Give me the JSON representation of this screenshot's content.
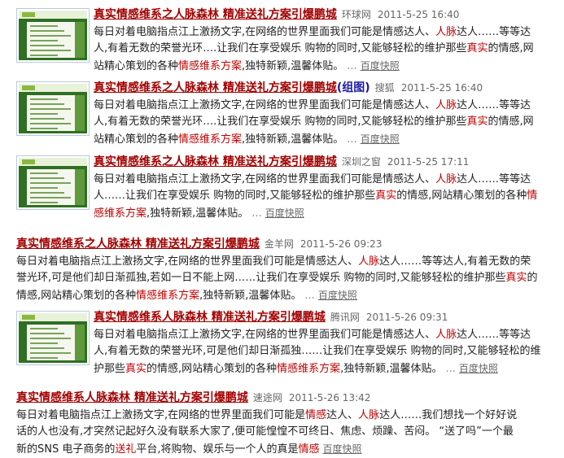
{
  "results": [
    {
      "title": "真实情感维系之人脉森林  精准送礼方案引爆鹏城",
      "source": "环球网",
      "time": "2011-5-25 16:40",
      "lines": [
        [
          "每日对着电脑指点江上激扬文字,在网络的世界里面我们可能是情感达人、",
          {
            "hl": "人脉"
          },
          "达人……等等达"
        ],
        [
          "人,有着无数的荣誉光环….让我们在享受娱乐 购物的同时,又能够轻松的维护那些",
          {
            "hl": "真实"
          },
          "的情感,网"
        ],
        [
          "站精心策划的各种",
          {
            "hl": "情感维系方案"
          },
          ",独特新颖,温馨体贴。"
        ]
      ],
      "dots": "...",
      "cache": "百度快照"
    },
    {
      "title": "真实情感维系之人脉森林  精准送礼方案引爆鹏城",
      "group": "(组图)",
      "source": "搜狐",
      "time": "2011-5-25 16:40",
      "lines": [
        [
          "每日对着电脑指点江上激扬文字,在网络的世界里面我们可能是情感达人、",
          {
            "hl": "人脉"
          },
          "达人……等等达"
        ],
        [
          "人,有着无数的荣誉光环….让我们在享受娱乐 购物的同时,又能够轻松的维护那些",
          {
            "hl": "真实"
          },
          "的情感,网"
        ],
        [
          "站精心策划的各种",
          {
            "hl": "情感维系方案"
          },
          ",独特新颖,温馨体贴。"
        ]
      ],
      "dots": "...",
      "cache": "百度快照"
    },
    {
      "title": "真实情感维系之人脉森林  精准送礼方案引爆鹏城",
      "source": "深圳之窗",
      "time": "2011-5-25 17:11",
      "lines": [
        [
          "每日对着电脑指点江上激扬文字,在网络的世界里面我们可能是情感达人、",
          {
            "hl": "人脉"
          },
          "达人……等等达"
        ],
        [
          "人……让我们在享受娱乐 购物的同时,又能够轻松的维护那些",
          {
            "hl": "真实"
          },
          "的情感,网站精心策划的各种",
          {
            "hl": "情"
          }
        ],
        [
          {
            "hl": "感维系方案"
          },
          ",独特新颖,温馨体贴。"
        ]
      ],
      "dots": "...",
      "cache": "百度快照"
    },
    {
      "title": "真实情感维系之人脉森林  精准送礼方案引爆鹏城",
      "source": "金羊网",
      "time": "2011-5-26 09:23",
      "lines": [
        [
          "每日对着电脑指点江上激扬文字,在网络的世界里面我们可能是情感达人、",
          {
            "hl": "人脉"
          },
          "达人……等等达人,有着无数的荣"
        ],
        [
          "誉光环,可是他们却日渐孤独,若如一日不能上网……让我们在享受娱乐 购物的同时,又能够轻松的维护那些",
          {
            "hl": "真实"
          },
          "的"
        ],
        [
          "情感,网站精心策划的各种",
          {
            "hl": "情感维系方案"
          },
          ",独特新颖,温馨体贴。"
        ]
      ],
      "dots": "...",
      "cache": "百度快照"
    },
    {
      "title": "真实情感维系人脉森林  精准送礼方案引爆鹏城",
      "source": "腾讯网",
      "time": "2011-5-26 09:31",
      "lines": [
        [
          "每日对着电脑指点江上激扬文字,在网络的世界里面我们可能是情感达人、",
          {
            "hl": "人脉"
          },
          "达人……等等达"
        ],
        [
          "人,有着无数的荣誉光环,可是他们却日渐孤独……让我们在享受娱乐 购物的同时,又能够轻松的维"
        ],
        [
          "护那些",
          {
            "hl": "真实"
          },
          "的情感,网站精心策划的各种",
          {
            "hl": "情感维系方案"
          },
          ",独特新颖,温馨体贴。"
        ]
      ],
      "dots": "...",
      "cache": "百度快照"
    },
    {
      "title": "真实情感维系人脉森林  精准送礼方案引爆鹏城",
      "source": "速途网",
      "time": "2011-5-26 13:42",
      "lines": [
        [
          "每日对着电脑指点江上激扬文字,在网络的世界里面我们可能是",
          {
            "hl": "情感"
          },
          "达人、",
          {
            "hl": "人脉"
          },
          "达人……我们想找一个好好说"
        ],
        [
          "话的人也没有,才突然记起好久没有联系大家了,便可能惶惶不可终日、焦虑、烦躁、苦闷。  “送了吗”一个最"
        ],
        [
          "新的SNS 电子商务的",
          {
            "hl": "送礼"
          },
          "平台,将购物、娱乐与一个人的真是",
          {
            "hl": "情感"
          }
        ]
      ],
      "dots": "",
      "cache": "百度快照"
    }
  ]
}
